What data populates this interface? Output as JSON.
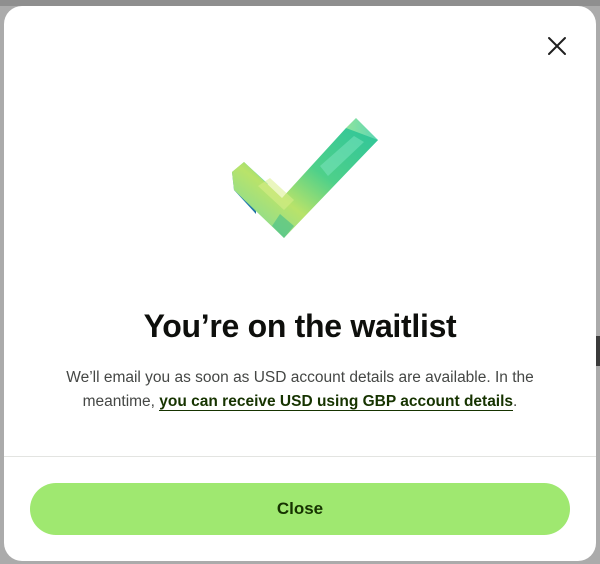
{
  "modal": {
    "close_icon": "close-icon",
    "hero_icon": "checkmark-icon",
    "title": "You’re on the waitlist",
    "body_prefix": "We’ll email you as soon as USD account details are available. In the meantime, ",
    "body_link": "you can receive USD using GBP account details",
    "body_suffix": ".",
    "close_button_label": "Close"
  },
  "colors": {
    "accent": "#9fe870",
    "accent_text": "#163300",
    "title_text": "#0e0f0c",
    "body_text": "#454745"
  }
}
